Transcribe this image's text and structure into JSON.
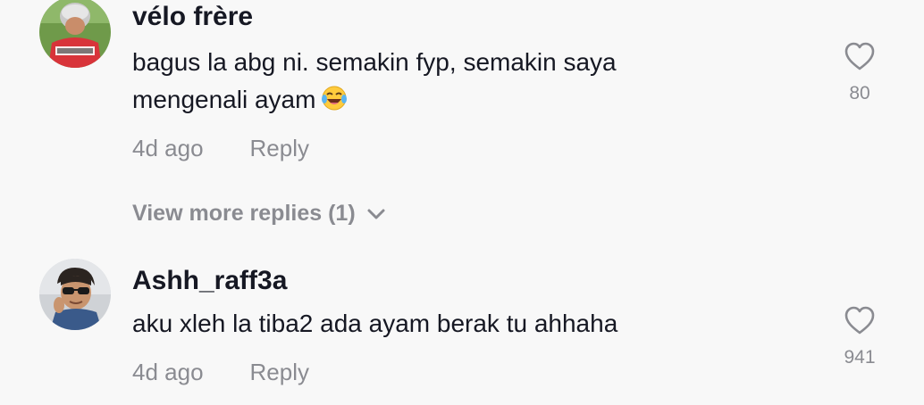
{
  "comments": [
    {
      "username": "vélo frère",
      "text_line1": "bagus la abg ni. semakin fyp, semakin saya",
      "text_line2": "mengenali ayam",
      "emoji": "face-with-tears-of-joy",
      "time": "4d ago",
      "reply_label": "Reply",
      "likes": "80"
    },
    {
      "username": "Ashh_raff3a",
      "text_line1": "aku xleh la tiba2 ada ayam berak tu ahhaha",
      "time": "4d ago",
      "reply_label": "Reply",
      "likes": "941"
    }
  ],
  "view_more_replies": "View more replies (1)",
  "icons": {
    "like": "heart-outline-icon",
    "expand": "chevron-down-icon"
  },
  "colors": {
    "background": "#f8f8f8",
    "primary_text": "#161823",
    "secondary_text": "#8a8b91"
  }
}
